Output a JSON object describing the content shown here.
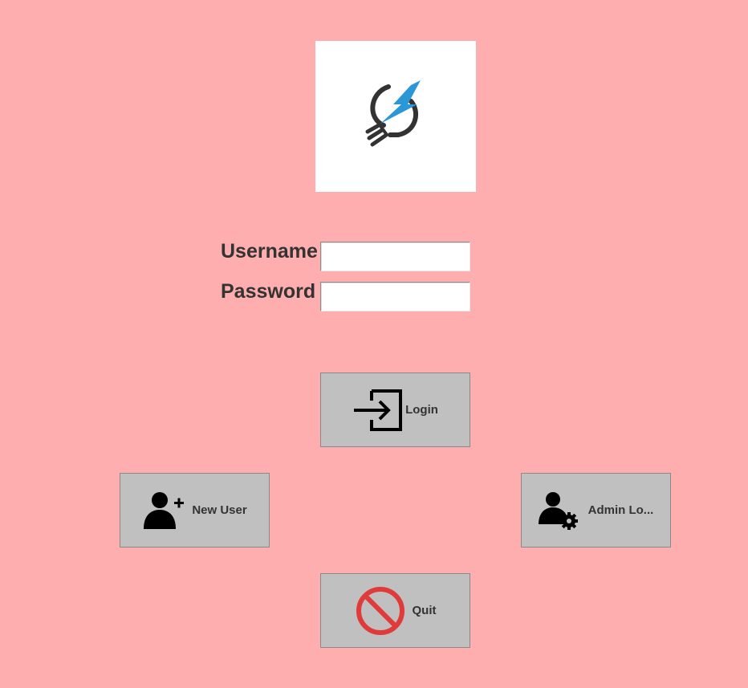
{
  "logo": {
    "icon": "lightbulb-lightning-icon",
    "accent_color": "#2b97d6",
    "dark_color": "#333333"
  },
  "form": {
    "username_label": "Username",
    "username_value": "",
    "password_label": "Password",
    "password_value": ""
  },
  "buttons": {
    "login": {
      "label": "Login",
      "icon": "sign-in-icon"
    },
    "new_user": {
      "label": "New User",
      "icon": "add-user-icon"
    },
    "admin_login": {
      "label": "Admin Lo...",
      "icon": "admin-user-gear-icon"
    },
    "quit": {
      "label": "Quit",
      "icon": "prohibited-icon",
      "icon_color": "#e03a3a"
    }
  },
  "colors": {
    "background": "#ffaeaf",
    "button_face": "#c0c0c0",
    "label_text": "#333333"
  }
}
